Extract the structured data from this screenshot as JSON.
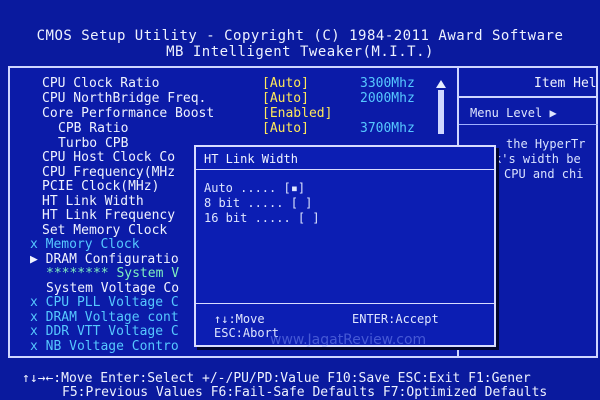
{
  "header": {
    "line1": "CMOS Setup Utility - Copyright (C) 1984-2011 Award Software",
    "line2": "MB Intelligent Tweaker(M.I.T.)"
  },
  "settings": [
    {
      "label": "CPU Clock Ratio",
      "value": "[Auto]",
      "extra": "3300Mhz"
    },
    {
      "label": "CPU NorthBridge Freq.",
      "value": "[Auto]",
      "extra": "2000Mhz"
    },
    {
      "label": "Core Performance Boost",
      "value": "[Enabled]",
      "extra": ""
    },
    {
      "label": "CPB Ratio",
      "value": "[Auto]",
      "extra": "3700Mhz"
    },
    {
      "label": "Turbo CPB",
      "value": "",
      "extra": ""
    },
    {
      "label": "CPU Host Clock Co",
      "value": "",
      "extra": ""
    },
    {
      "label": "CPU Frequency(MHz",
      "value": "",
      "extra": ""
    },
    {
      "label": "PCIE Clock(MHz)",
      "value": "",
      "extra": ""
    },
    {
      "label": "HT Link Width",
      "value": "",
      "extra": ""
    },
    {
      "label": "HT Link Frequency",
      "value": "",
      "extra": ""
    },
    {
      "label": "Set Memory Clock",
      "value": "",
      "extra": ""
    },
    {
      "label": "x Memory Clock",
      "value": "",
      "extra": ""
    },
    {
      "label": "▶ DRAM Configuratio",
      "value": "",
      "extra": ""
    },
    {
      "label": "******** System V",
      "value": "",
      "extra": ""
    },
    {
      "label": "System Voltage Co",
      "value": "",
      "extra": ""
    },
    {
      "label": "x CPU PLL Voltage C",
      "value": "",
      "extra": ""
    },
    {
      "label": "x DRAM Voltage cont",
      "value": "",
      "extra": ""
    },
    {
      "label": "x DDR VTT Voltage C",
      "value": "",
      "extra": ""
    },
    {
      "label": "x NB Voltage Contro",
      "value": "",
      "extra": ""
    }
  ],
  "help": {
    "title": "Item Hel",
    "menu_level": "Menu Level  ▶",
    "lines": [
      "the HyperTr",
      "k's width be",
      "CPU and chi"
    ]
  },
  "dialog": {
    "title": "HT Link Width",
    "options": [
      {
        "label": "Auto ..... [▪]"
      },
      {
        "label": " 8 bit ..... [ ]"
      },
      {
        "label": "16 bit ..... [ ]"
      }
    ],
    "move": "↑↓:Move",
    "enter": "ENTER:Accept",
    "esc": "ESC:Abort"
  },
  "footer": {
    "line1": "↑↓→←:Move  Enter:Select  +/-/PU/PD:Value  F10:Save  ESC:Exit  F1:Gener",
    "line2": "F5:Previous Values  F6:Fail-Safe Defaults  F7:Optimized Defaults"
  },
  "watermark": "www.JagatReview.com",
  "colors": {
    "background": "#0a1a9e",
    "value_yellow": "#ffe85a",
    "freq_cyan": "#56c8ff",
    "disabled_cyan": "#56c8ff",
    "text_white": "#f0f3ff"
  }
}
